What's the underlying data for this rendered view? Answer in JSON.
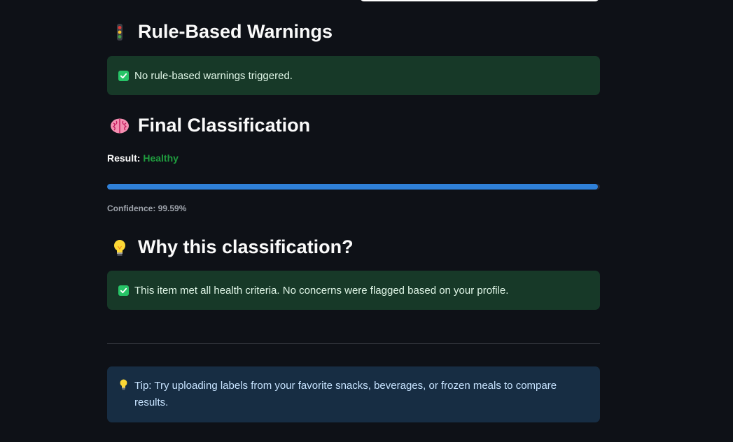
{
  "warnings": {
    "heading": "Rule-Based Warnings",
    "icon": "traffic-light-icon",
    "message": "No rule-based warnings triggered."
  },
  "classification": {
    "heading": "Final Classification",
    "icon": "brain-icon",
    "result_label": "Result:",
    "result_value": "Healthy",
    "confidence_percent": 99.59,
    "confidence_text": "Confidence: 99.59%"
  },
  "explanation": {
    "heading": "Why this classification?",
    "icon": "light-bulb-icon",
    "message": "This item met all health criteria. No concerns were flagged based on your profile."
  },
  "tip": {
    "icon": "light-bulb-icon",
    "text": "Tip: Try uploading labels from your favorite snacks, beverages, or frozen meals to compare results."
  },
  "colors": {
    "background": "#0e1117",
    "success_bg": "#173928",
    "info_bg": "#172d43",
    "healthy": "#1f9c3e",
    "progress": "#2f80d8"
  }
}
